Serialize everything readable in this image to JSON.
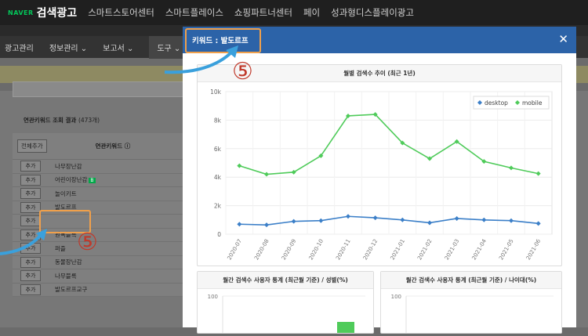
{
  "topnav": {
    "logo": "NAVER",
    "title": "검색광고",
    "links": [
      "스마트스토어센터",
      "스마트플레이스",
      "쇼핑파트너센터",
      "페이",
      "성과형디스플레이광고"
    ]
  },
  "menubar": {
    "items": [
      "광고관리",
      "정보관리 ⌄",
      "보고서 ⌄",
      "도구 ⌄"
    ]
  },
  "results": {
    "title": "연관키워드 조회 결과",
    "count": "(473개)",
    "add_all": "전체추가",
    "column": "연관키워드 ⓘ",
    "add_label": "추가",
    "keywords": [
      "나무장난감",
      "어린이장난감",
      "놀이키트",
      "발도르프",
      "",
      "원목블록",
      "퍼즐",
      "동물장난감",
      "나무블록",
      "발도르프교구"
    ],
    "badge": "B"
  },
  "callouts": {
    "number": "⑤"
  },
  "modal": {
    "title": "키워드 : 발도르프",
    "close": "✕"
  },
  "chart_data": [
    {
      "type": "line",
      "title": "월별 검색수 추이 (최근 1년)",
      "categories": [
        "2020-07",
        "2020-08",
        "2020-09",
        "2020-10",
        "2020-11",
        "2020-12",
        "2021-01",
        "2021-02",
        "2021-03",
        "2021-04",
        "2021-05",
        "2021-06"
      ],
      "series": [
        {
          "name": "desktop",
          "color": "#3b7fc8",
          "values": [
            700,
            650,
            900,
            950,
            1250,
            1150,
            1000,
            800,
            1100,
            1000,
            950,
            750
          ]
        },
        {
          "name": "mobile",
          "color": "#4fcb5a",
          "values": [
            4800,
            4200,
            4350,
            5500,
            8300,
            8400,
            6400,
            5300,
            6500,
            5100,
            4650,
            4250
          ]
        }
      ],
      "ylim": [
        0,
        10000
      ],
      "yticks": [
        "0",
        "2k",
        "4k",
        "6k",
        "8k",
        "10k"
      ],
      "legend": "top-right",
      "grid": true
    },
    {
      "type": "bar",
      "title": "월간 검색수 사용자 통계 (최근월 기준) / 성별(%)",
      "ylim": [
        0,
        100
      ],
      "yticks": [
        "100"
      ]
    },
    {
      "type": "bar",
      "title": "월간 검색수 사용자 통계 (최근월 기준) / 나이대(%)",
      "ylim": [
        0,
        100
      ],
      "yticks": [
        "100"
      ]
    }
  ]
}
